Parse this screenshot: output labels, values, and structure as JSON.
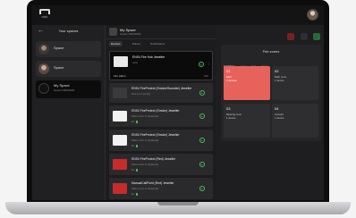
{
  "app": {
    "logo_text": "ЯND"
  },
  "spaces_panel": {
    "title": "Your spaces",
    "items": [
      {
        "name": "Space",
        "sub": ""
      },
      {
        "name": "Space",
        "sub": ""
      },
      {
        "name": "My Space",
        "sub": "Guard 1000/0000"
      }
    ]
  },
  "space_header": {
    "name": "My Space",
    "sub": "Guard 1000/0000"
  },
  "tabs": [
    "Devices",
    "Places",
    "Notifications"
  ],
  "devices": [
    {
      "title": "ENS4 Fire Hub Jeweller",
      "status": "sold",
      "meta": "m",
      "foot": "Fire Alarm",
      "foot2": "Info",
      "selected": true,
      "color": "#e9e9e9"
    },
    {
      "title": "ENS4 FireProtect (Smoke/Sounder) Jeweller",
      "status": "Hub is in (Gray)",
      "meta": "m",
      "selected": false,
      "color": "#3a3a3c"
    },
    {
      "title": "ENS4 FireProtect (Smoke) Jeweller",
      "status": "Main room in Space(2)",
      "meta": "m",
      "selected": false,
      "color": "#f2f2f2"
    },
    {
      "title": "ENS4 FireProtect (Smoke) Jeweller",
      "status": "Main room in Space(2)",
      "meta": "m",
      "selected": false,
      "color": "#f2f2f2"
    },
    {
      "title": "ENS4 FireProtect (Red) Jeweller",
      "status": "Main room in Space(2)",
      "meta": "m",
      "selected": false,
      "color": "#c62c2c"
    },
    {
      "title": "ManualCallPoint (Red) Jeweller",
      "status": "Main room in Space(2)",
      "meta": "m",
      "selected": false,
      "color": "#c62c2c"
    }
  ],
  "fire_zones": {
    "title": "Fire zones",
    "tabs": [
      "Installation",
      "Lead",
      "Test",
      "Reset"
    ],
    "zones": [
      {
        "num": "01",
        "l1": "Alert",
        "l2": "2 devices",
        "hot": true
      },
      {
        "num": "02",
        "l1": "Main room",
        "l2": "1 device",
        "hot": false
      },
      {
        "num": "03",
        "l1": "Meeting room",
        "l2": "1 device",
        "hot": false
      },
      {
        "num": "04",
        "l1": "Corridor",
        "l2": "1 device",
        "hot": false
      }
    ]
  },
  "colors": {
    "alert": "#e8625c",
    "online": "#4caf50"
  },
  "icons": {
    "back": "arrow-left-icon",
    "play": "play-icon",
    "chevron": "chevron-right-icon"
  }
}
